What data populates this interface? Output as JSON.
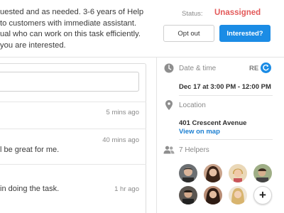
{
  "task": {
    "description_lines": [
      "uested and as needed. 3-6 years of Help",
      "to customers with immediate assistant.",
      "ual who can work on this task efficiently.",
      "you are interested."
    ],
    "status_label": "Status:",
    "status_value": "Unassigned",
    "opt_out_label": "Opt out",
    "interested_label": "Interested?"
  },
  "comments": [
    {
      "text": "",
      "time": "5 mins ago"
    },
    {
      "text": "l be great for me.",
      "time": "40 mins ago"
    },
    {
      "text": "in doing the task.",
      "time": "1 hr ago"
    }
  ],
  "details": {
    "date_label": "Date & time",
    "re_label": "RE",
    "datetime": "Dec 17 at 3:00 PM - 12:00 PM",
    "location_label": "Location",
    "address": "401 Crescent Avenue",
    "map_link": "View on map",
    "helpers_label": "7 Helpers",
    "add_helper": "+"
  },
  "colors": {
    "accent": "#1b8ce5",
    "status_unassigned": "#e35a5a",
    "link": "#1b7fd1"
  },
  "icons": [
    "clock-icon",
    "refresh-icon",
    "location-pin-icon",
    "people-icon",
    "plus-icon"
  ]
}
